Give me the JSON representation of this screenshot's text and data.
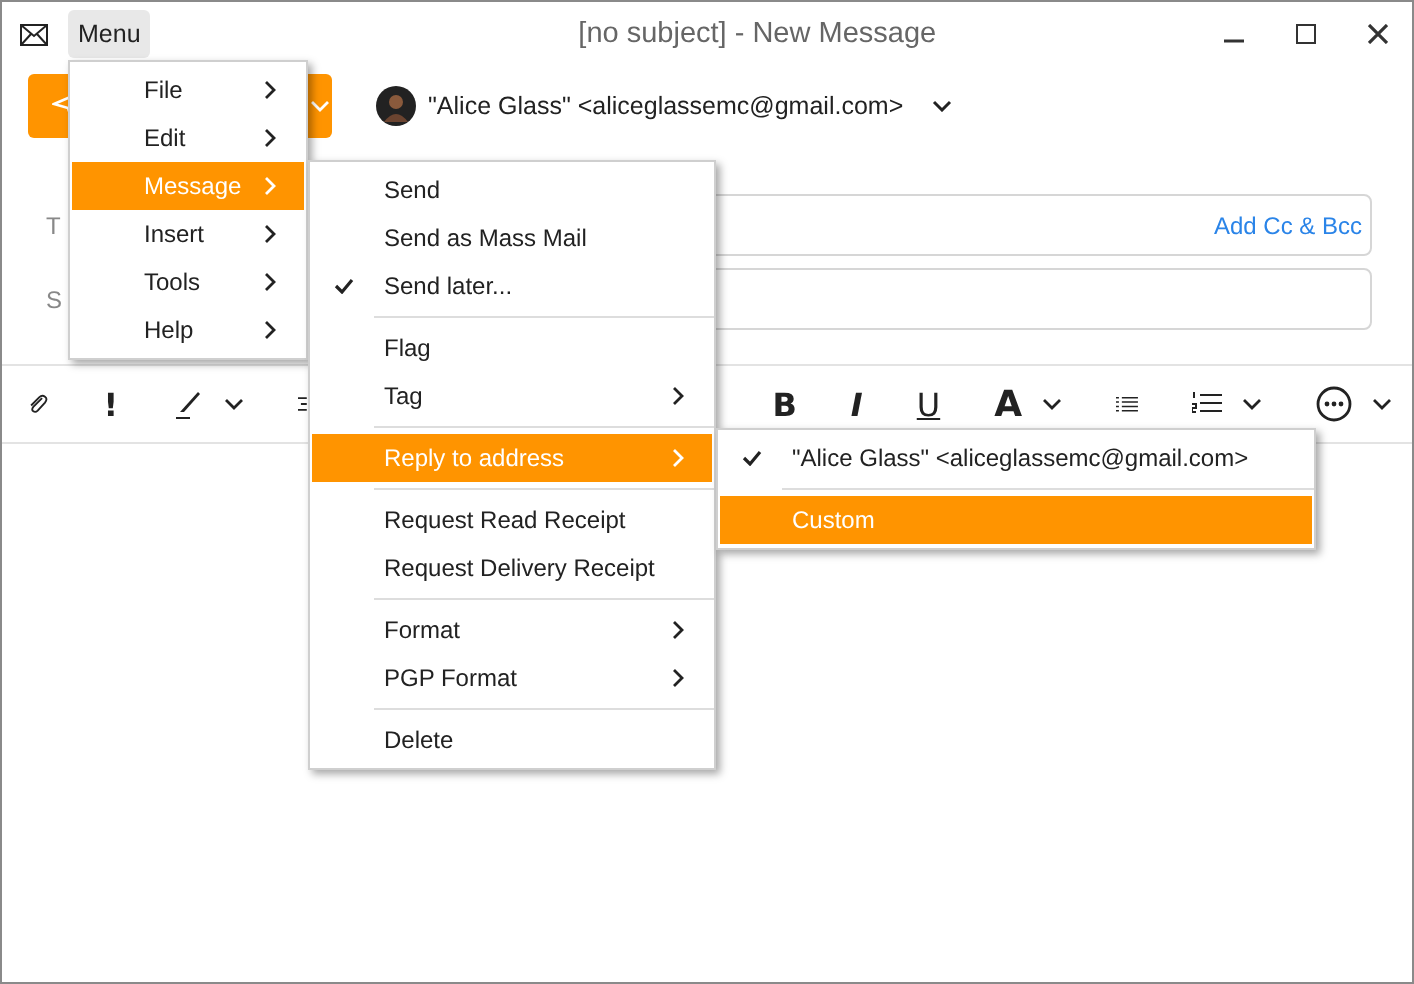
{
  "window": {
    "title": "[no subject] - New Message",
    "menu_button": "Menu"
  },
  "identity": {
    "from": "\"Alice Glass\" <aliceglassemc@gmail.com>"
  },
  "fields": [
    {
      "label": "T",
      "action": "Add Cc & Bcc"
    },
    {
      "label": "S"
    }
  ],
  "toolbar": [
    {
      "kind": "attach"
    },
    {
      "kind": "priority",
      "text": "!"
    },
    {
      "kind": "pen"
    },
    {
      "kind": "format"
    },
    {
      "kind": "bold",
      "text": "B"
    },
    {
      "kind": "italic",
      "text": "I"
    },
    {
      "kind": "underline",
      "text": "U"
    },
    {
      "kind": "color",
      "text": "A"
    },
    {
      "kind": "bullets"
    },
    {
      "kind": "numbers"
    },
    {
      "kind": "more"
    }
  ],
  "menus": [
    {
      "items": [
        {
          "kind": "item",
          "label": "File",
          "submenu": true,
          "selected": false,
          "checked": false
        },
        {
          "kind": "item",
          "label": "Edit",
          "submenu": true,
          "selected": false,
          "checked": false
        },
        {
          "kind": "item",
          "label": "Message",
          "submenu": true,
          "selected": true,
          "checked": false
        },
        {
          "kind": "item",
          "label": "Insert",
          "submenu": true,
          "selected": false,
          "checked": false
        },
        {
          "kind": "item",
          "label": "Tools",
          "submenu": true,
          "selected": false,
          "checked": false
        },
        {
          "kind": "item",
          "label": "Help",
          "submenu": true,
          "selected": false,
          "checked": false
        }
      ]
    },
    {
      "items": [
        {
          "kind": "item",
          "label": "Send",
          "submenu": false,
          "selected": false,
          "checked": false
        },
        {
          "kind": "item",
          "label": "Send as Mass Mail",
          "submenu": false,
          "selected": false,
          "checked": false
        },
        {
          "kind": "item",
          "label": "Send later...",
          "submenu": false,
          "selected": false,
          "checked": true
        },
        {
          "kind": "separator"
        },
        {
          "kind": "item",
          "label": "Flag",
          "submenu": false,
          "selected": false,
          "checked": false
        },
        {
          "kind": "item",
          "label": "Tag",
          "submenu": true,
          "selected": false,
          "checked": false
        },
        {
          "kind": "separator"
        },
        {
          "kind": "item",
          "label": "Reply to address",
          "submenu": true,
          "selected": true,
          "checked": false
        },
        {
          "kind": "separator"
        },
        {
          "kind": "item",
          "label": "Request Read Receipt",
          "submenu": false,
          "selected": false,
          "checked": false
        },
        {
          "kind": "item",
          "label": "Request Delivery Receipt",
          "submenu": false,
          "selected": false,
          "checked": false
        },
        {
          "kind": "separator"
        },
        {
          "kind": "item",
          "label": "Format",
          "submenu": true,
          "selected": false,
          "checked": false
        },
        {
          "kind": "item",
          "label": "PGP Format",
          "submenu": true,
          "selected": false,
          "checked": false
        },
        {
          "kind": "separator"
        },
        {
          "kind": "item",
          "label": "Delete",
          "submenu": false,
          "selected": false,
          "checked": false
        }
      ]
    },
    {
      "items": [
        {
          "kind": "item",
          "label": "\"Alice Glass\" <aliceglassemc@gmail.com>",
          "submenu": false,
          "selected": false,
          "checked": true
        },
        {
          "kind": "separator"
        },
        {
          "kind": "item",
          "label": "Custom",
          "submenu": false,
          "selected": true,
          "checked": false
        }
      ]
    }
  ]
}
